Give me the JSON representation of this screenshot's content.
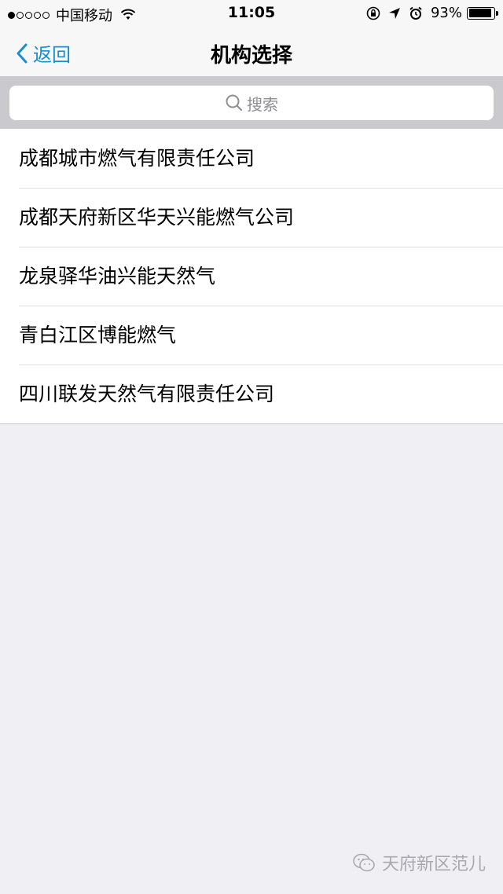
{
  "status_bar": {
    "carrier": "中国移动",
    "time": "11:05",
    "battery": "93%",
    "battery_level": 0.93,
    "signal_bars_filled": 1,
    "signal_bars_total": 5
  },
  "nav": {
    "back_label": "返回",
    "title": "机构选择"
  },
  "search": {
    "placeholder": "搜索"
  },
  "list": {
    "items": [
      {
        "label": "成都城市燃气有限责任公司"
      },
      {
        "label": "成都天府新区华天兴能燃气公司"
      },
      {
        "label": "龙泉驿华油兴能天然气"
      },
      {
        "label": "青白江区博能燃气"
      },
      {
        "label": "四川联发天然气有限责任公司"
      }
    ]
  },
  "watermark": {
    "text": "天府新区范儿"
  },
  "colors": {
    "accent": "#1a8fd0",
    "background": "#efeff4",
    "search_bar_bg": "#c9c9ce"
  }
}
